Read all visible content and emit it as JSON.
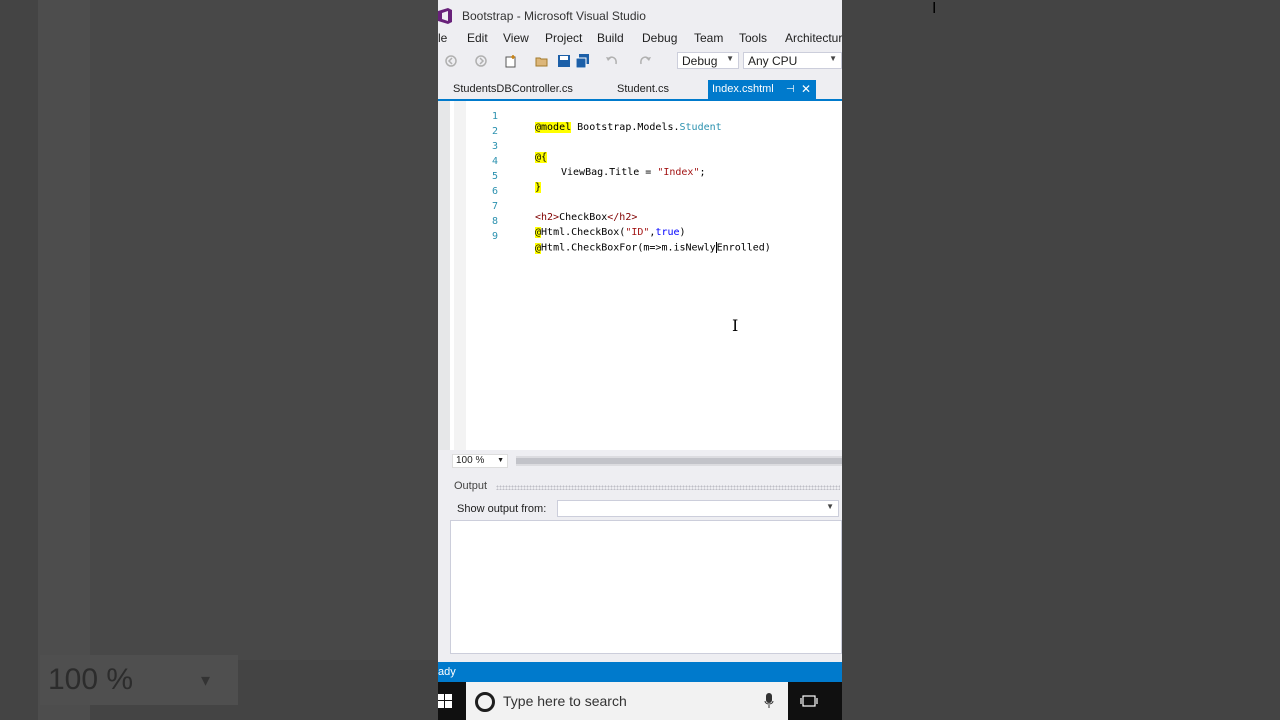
{
  "window": {
    "title": "Bootstrap - Microsoft Visual Studio"
  },
  "menu": [
    "le",
    "Edit",
    "View",
    "Project",
    "Build",
    "Debug",
    "Team",
    "Tools",
    "Architecture"
  ],
  "toolbar": {
    "config": "Debug",
    "platform": "Any CPU"
  },
  "tabs": [
    {
      "label": "StudentsDBController.cs",
      "active": false
    },
    {
      "label": "Student.cs",
      "active": false
    },
    {
      "label": "Index.cshtml",
      "active": true
    }
  ],
  "code_lines": [
    {
      "n": "1"
    },
    {
      "n": "2"
    },
    {
      "n": "3"
    },
    {
      "n": "4"
    },
    {
      "n": "5"
    },
    {
      "n": "6"
    },
    {
      "n": "7"
    },
    {
      "n": "8"
    },
    {
      "n": "9"
    }
  ],
  "code": {
    "l1_kw": "@model",
    "l1_ns": "Bootstrap.Models.",
    "l1_type": "Student",
    "l3": "@{",
    "l4_a": "ViewBag.Title = ",
    "l4_str": "\"Index\"",
    "l4_end": ";",
    "l5": "}",
    "l7_open": "<h2>",
    "l7_text": "CheckBox",
    "l7_close": "</h2>",
    "l8_at": "@",
    "l8_a": "Html.CheckBox(",
    "l8_str": "\"ID\"",
    "l8_comma": ",",
    "l8_kw": "true",
    "l8_end": ")",
    "l9_at": "@",
    "l9_a": "Html.CheckBoxFor(m=>m.isNewly",
    "l9_b": "Enrolled)"
  },
  "zoom": "100 %",
  "output": {
    "title": "Output",
    "show_label": "Show output from:",
    "show_value": ""
  },
  "status": {
    "text": "ady"
  },
  "taskbar": {
    "search_placeholder": "Type here to search"
  },
  "background": {
    "zoom_ghost": "100 %"
  },
  "colors": {
    "accent": "#007acc",
    "vs_purple": "#68217a"
  }
}
